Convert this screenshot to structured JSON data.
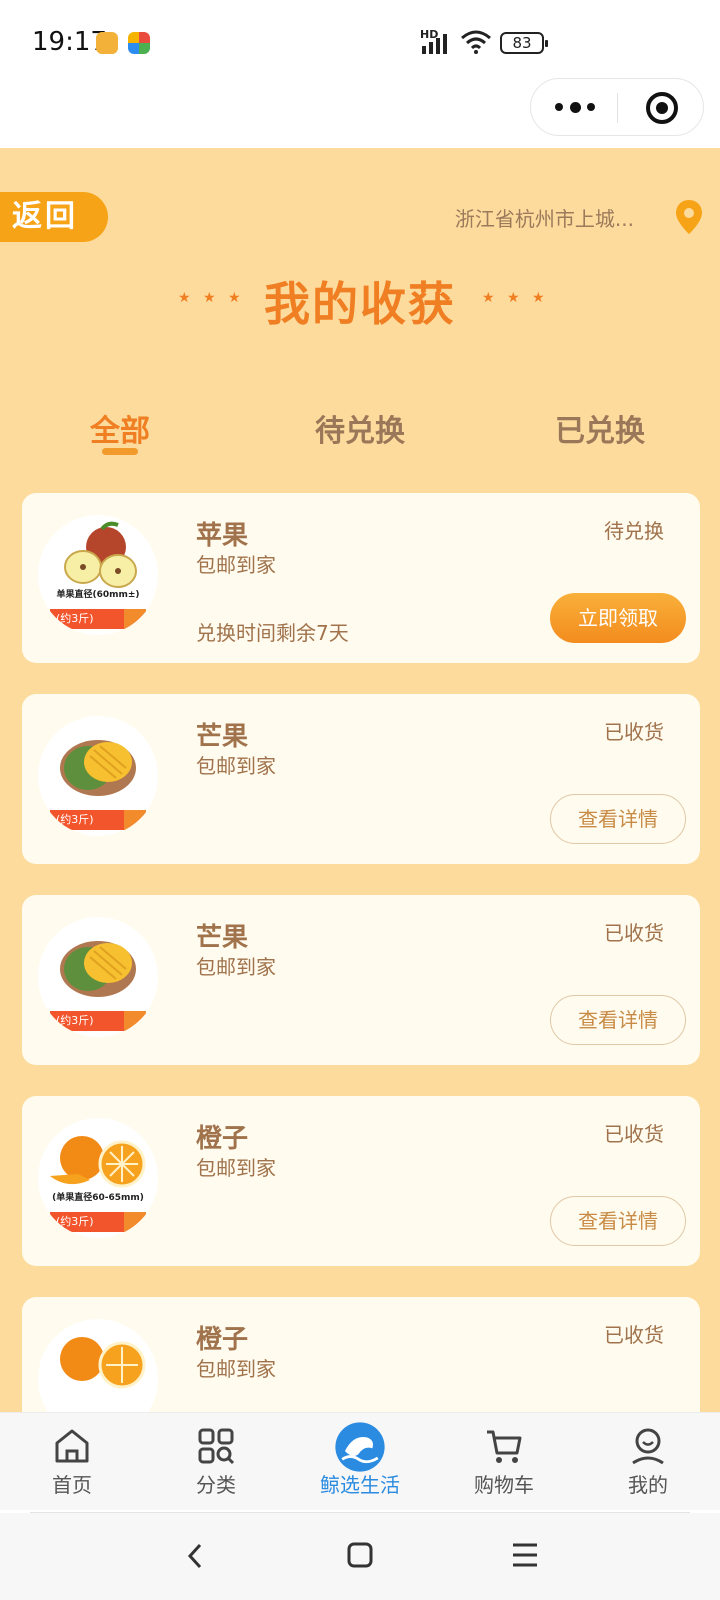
{
  "status_bar": {
    "time": "19:17",
    "network": "HD",
    "battery": "83"
  },
  "header": {
    "back_label": "返回",
    "location": "浙江省杭州市上城...",
    "title": "我的收获",
    "stars_left": "★ ★ ★",
    "stars_right": "★ ★ ★"
  },
  "tabs": [
    {
      "label": "全部",
      "active": true
    },
    {
      "label": "待兑换",
      "active": false
    },
    {
      "label": "已兑换",
      "active": false
    }
  ],
  "cards": [
    {
      "name": "苹果",
      "subtitle": "包邮到家",
      "status": "待兑换",
      "timer": "兑换时间剩余7天",
      "button": "立即领取",
      "thumb_caption": "单果直径(60mm±)",
      "ribbon": "(约3斤)",
      "fruit": "apple"
    },
    {
      "name": "芒果",
      "subtitle": "包邮到家",
      "status": "已收货",
      "button": "查看详情",
      "ribbon": "(约3斤)",
      "fruit": "mango"
    },
    {
      "name": "芒果",
      "subtitle": "包邮到家",
      "status": "已收货",
      "button": "查看详情",
      "ribbon": "(约3斤)",
      "fruit": "mango"
    },
    {
      "name": "橙子",
      "subtitle": "包邮到家",
      "status": "已收货",
      "button": "查看详情",
      "thumb_caption": "(单果直径60-65mm)",
      "ribbon": "(约3斤)",
      "fruit": "orange"
    },
    {
      "name": "橙子",
      "subtitle": "包邮到家",
      "status": "已收货",
      "fruit": "orange"
    }
  ],
  "bottom_nav": [
    {
      "label": "首页",
      "icon": "home-icon"
    },
    {
      "label": "分类",
      "icon": "category-icon"
    },
    {
      "label": "鲸选生活",
      "icon": "whale-icon",
      "active": true
    },
    {
      "label": "购物车",
      "icon": "cart-icon"
    },
    {
      "label": "我的",
      "icon": "profile-icon"
    }
  ],
  "colors": {
    "accent": "#f07e22",
    "background": "#fddb9c",
    "card": "#fffbee",
    "text": "#a0734c",
    "nav_active": "#2a8be0"
  }
}
